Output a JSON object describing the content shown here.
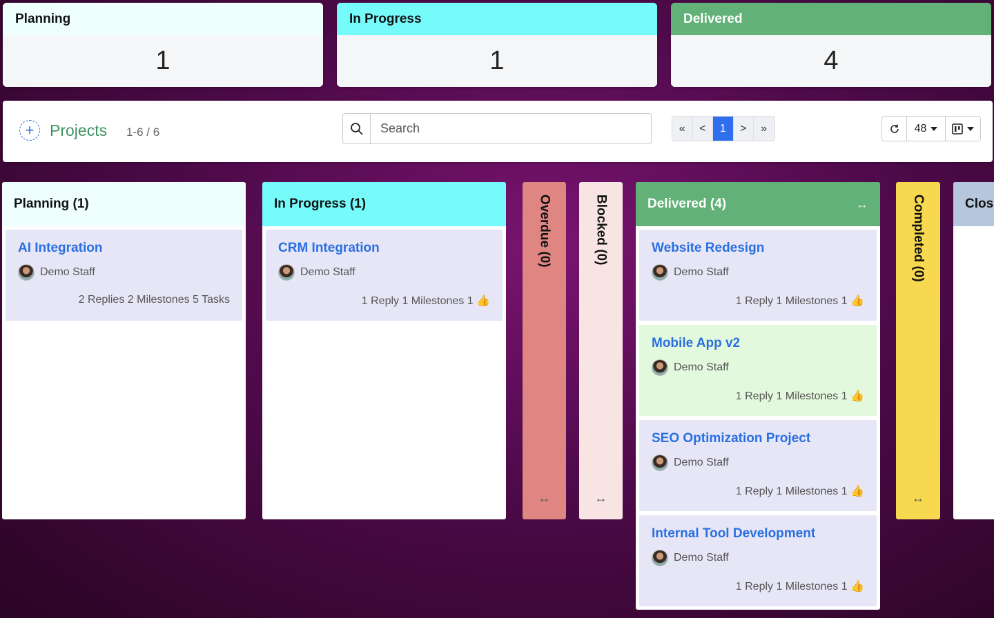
{
  "summary": [
    {
      "label": "Planning",
      "count": "1",
      "color": "#effffe"
    },
    {
      "label": "In Progress",
      "count": "1",
      "color": "#76fbfb"
    },
    {
      "label": "Delivered",
      "count": "4",
      "color": "#62b178"
    }
  ],
  "toolbar": {
    "add_icon": "plus-circle-icon",
    "title": "Projects",
    "range": "1-6 / 6",
    "search_placeholder": "Search",
    "pager": {
      "first": "«",
      "prev": "<",
      "current": "1",
      "next": ">",
      "last": "»"
    },
    "refresh_icon": "refresh-icon",
    "page_size": "48",
    "view_icon": "kanban-view-icon"
  },
  "columns": {
    "planning": {
      "label": "Planning (1)",
      "color": "#effffe",
      "cards": [
        {
          "title": "AI Integration",
          "user": "Demo Staff",
          "meta": "2 Replies 2 Milestones 5 Tasks",
          "bg": "#e6e6f7"
        }
      ]
    },
    "in_progress": {
      "label": "In Progress (1)",
      "color": "#76fbfb",
      "cards": [
        {
          "title": "CRM Integration",
          "user": "Demo Staff",
          "meta": "1 Reply 1 Milestones 1",
          "bg": "#e6e6f7"
        }
      ]
    },
    "overdue": {
      "label": "Overdue (0)",
      "color": "#e08682",
      "expand": "↔"
    },
    "blocked": {
      "label": "Blocked (0)",
      "color": "#f9e4e4",
      "expand": "↔"
    },
    "delivered": {
      "label": "Delivered (4)",
      "color": "#62b178",
      "expand": "↔",
      "cards": [
        {
          "title": "Website Redesign",
          "user": "Demo Staff",
          "meta": "1 Reply 1 Milestones 1",
          "bg": "#e6e6f7"
        },
        {
          "title": "Mobile App v2",
          "user": "Demo Staff",
          "meta": "1 Reply 1 Milestones 1",
          "bg": "#e3f9dd"
        },
        {
          "title": "SEO Optimization Project",
          "user": "Demo Staff",
          "meta": "1 Reply 1 Milestones 1",
          "bg": "#e6e6f7"
        },
        {
          "title": "Internal Tool Development",
          "user": "Demo Staff",
          "meta": "1 Reply 1 Milestones 1",
          "bg": "#e6e6f7"
        }
      ]
    },
    "completed": {
      "label": "Completed (0)",
      "color": "#f7d84f",
      "expand": "↔"
    },
    "closed": {
      "label": "Clos",
      "color": "#b6c6dd"
    }
  },
  "like_icon": "thumbs-up-icon",
  "like_glyph": "👍"
}
